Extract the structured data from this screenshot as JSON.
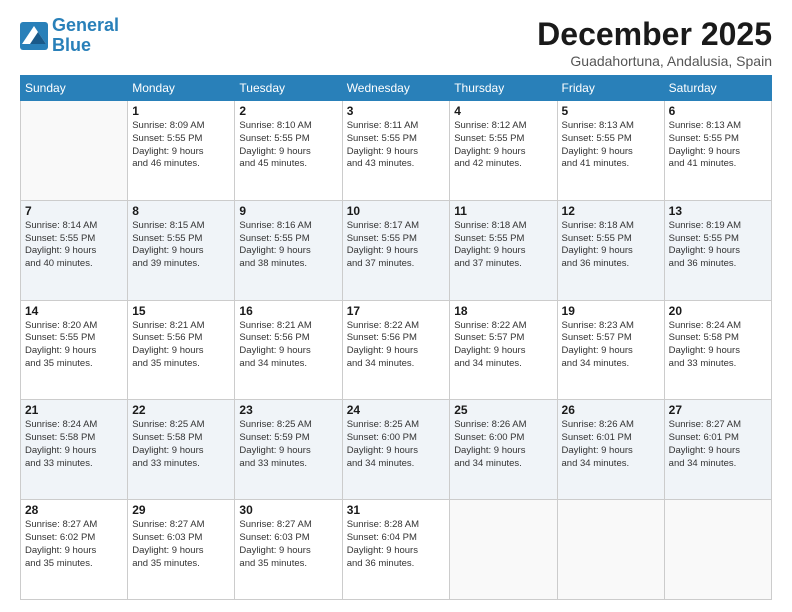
{
  "logo": {
    "line1": "General",
    "line2": "Blue"
  },
  "title": "December 2025",
  "subtitle": "Guadahortuna, Andalusia, Spain",
  "days_of_week": [
    "Sunday",
    "Monday",
    "Tuesday",
    "Wednesday",
    "Thursday",
    "Friday",
    "Saturday"
  ],
  "weeks": [
    [
      {
        "num": "",
        "info": ""
      },
      {
        "num": "1",
        "info": "Sunrise: 8:09 AM\nSunset: 5:55 PM\nDaylight: 9 hours\nand 46 minutes."
      },
      {
        "num": "2",
        "info": "Sunrise: 8:10 AM\nSunset: 5:55 PM\nDaylight: 9 hours\nand 45 minutes."
      },
      {
        "num": "3",
        "info": "Sunrise: 8:11 AM\nSunset: 5:55 PM\nDaylight: 9 hours\nand 43 minutes."
      },
      {
        "num": "4",
        "info": "Sunrise: 8:12 AM\nSunset: 5:55 PM\nDaylight: 9 hours\nand 42 minutes."
      },
      {
        "num": "5",
        "info": "Sunrise: 8:13 AM\nSunset: 5:55 PM\nDaylight: 9 hours\nand 41 minutes."
      },
      {
        "num": "6",
        "info": "Sunrise: 8:13 AM\nSunset: 5:55 PM\nDaylight: 9 hours\nand 41 minutes."
      }
    ],
    [
      {
        "num": "7",
        "info": "Sunrise: 8:14 AM\nSunset: 5:55 PM\nDaylight: 9 hours\nand 40 minutes."
      },
      {
        "num": "8",
        "info": "Sunrise: 8:15 AM\nSunset: 5:55 PM\nDaylight: 9 hours\nand 39 minutes."
      },
      {
        "num": "9",
        "info": "Sunrise: 8:16 AM\nSunset: 5:55 PM\nDaylight: 9 hours\nand 38 minutes."
      },
      {
        "num": "10",
        "info": "Sunrise: 8:17 AM\nSunset: 5:55 PM\nDaylight: 9 hours\nand 37 minutes."
      },
      {
        "num": "11",
        "info": "Sunrise: 8:18 AM\nSunset: 5:55 PM\nDaylight: 9 hours\nand 37 minutes."
      },
      {
        "num": "12",
        "info": "Sunrise: 8:18 AM\nSunset: 5:55 PM\nDaylight: 9 hours\nand 36 minutes."
      },
      {
        "num": "13",
        "info": "Sunrise: 8:19 AM\nSunset: 5:55 PM\nDaylight: 9 hours\nand 36 minutes."
      }
    ],
    [
      {
        "num": "14",
        "info": "Sunrise: 8:20 AM\nSunset: 5:55 PM\nDaylight: 9 hours\nand 35 minutes."
      },
      {
        "num": "15",
        "info": "Sunrise: 8:21 AM\nSunset: 5:56 PM\nDaylight: 9 hours\nand 35 minutes."
      },
      {
        "num": "16",
        "info": "Sunrise: 8:21 AM\nSunset: 5:56 PM\nDaylight: 9 hours\nand 34 minutes."
      },
      {
        "num": "17",
        "info": "Sunrise: 8:22 AM\nSunset: 5:56 PM\nDaylight: 9 hours\nand 34 minutes."
      },
      {
        "num": "18",
        "info": "Sunrise: 8:22 AM\nSunset: 5:57 PM\nDaylight: 9 hours\nand 34 minutes."
      },
      {
        "num": "19",
        "info": "Sunrise: 8:23 AM\nSunset: 5:57 PM\nDaylight: 9 hours\nand 34 minutes."
      },
      {
        "num": "20",
        "info": "Sunrise: 8:24 AM\nSunset: 5:58 PM\nDaylight: 9 hours\nand 33 minutes."
      }
    ],
    [
      {
        "num": "21",
        "info": "Sunrise: 8:24 AM\nSunset: 5:58 PM\nDaylight: 9 hours\nand 33 minutes."
      },
      {
        "num": "22",
        "info": "Sunrise: 8:25 AM\nSunset: 5:58 PM\nDaylight: 9 hours\nand 33 minutes."
      },
      {
        "num": "23",
        "info": "Sunrise: 8:25 AM\nSunset: 5:59 PM\nDaylight: 9 hours\nand 33 minutes."
      },
      {
        "num": "24",
        "info": "Sunrise: 8:25 AM\nSunset: 6:00 PM\nDaylight: 9 hours\nand 34 minutes."
      },
      {
        "num": "25",
        "info": "Sunrise: 8:26 AM\nSunset: 6:00 PM\nDaylight: 9 hours\nand 34 minutes."
      },
      {
        "num": "26",
        "info": "Sunrise: 8:26 AM\nSunset: 6:01 PM\nDaylight: 9 hours\nand 34 minutes."
      },
      {
        "num": "27",
        "info": "Sunrise: 8:27 AM\nSunset: 6:01 PM\nDaylight: 9 hours\nand 34 minutes."
      }
    ],
    [
      {
        "num": "28",
        "info": "Sunrise: 8:27 AM\nSunset: 6:02 PM\nDaylight: 9 hours\nand 35 minutes."
      },
      {
        "num": "29",
        "info": "Sunrise: 8:27 AM\nSunset: 6:03 PM\nDaylight: 9 hours\nand 35 minutes."
      },
      {
        "num": "30",
        "info": "Sunrise: 8:27 AM\nSunset: 6:03 PM\nDaylight: 9 hours\nand 35 minutes."
      },
      {
        "num": "31",
        "info": "Sunrise: 8:28 AM\nSunset: 6:04 PM\nDaylight: 9 hours\nand 36 minutes."
      },
      {
        "num": "",
        "info": ""
      },
      {
        "num": "",
        "info": ""
      },
      {
        "num": "",
        "info": ""
      }
    ]
  ]
}
